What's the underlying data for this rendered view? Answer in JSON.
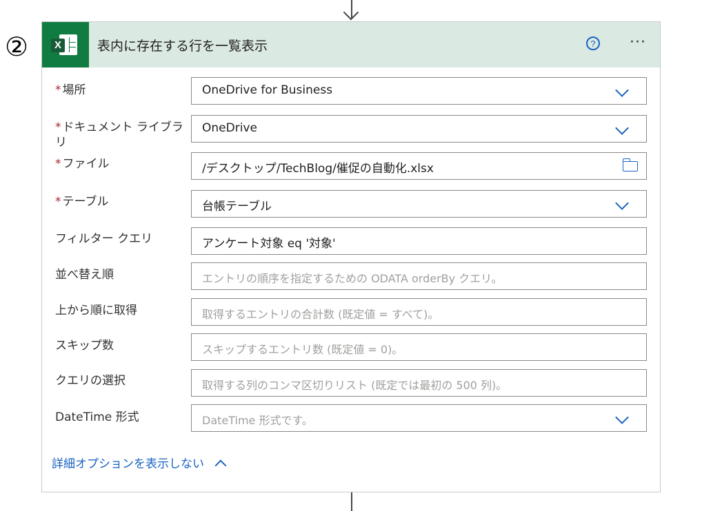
{
  "step_number": "②",
  "card": {
    "title": "表内に存在する行を一覧表示",
    "help_symbol": "?",
    "more_symbol": "···",
    "excel_letter": "X"
  },
  "fields": [
    {
      "label": "場所",
      "required": true,
      "value": "OneDrive for Business",
      "placeholder": "",
      "control": "dropdown"
    },
    {
      "label": "ドキュメント ライブラリ",
      "required": true,
      "value": "OneDrive",
      "placeholder": "",
      "control": "dropdown"
    },
    {
      "label": "ファイル",
      "required": true,
      "value": "/デスクトップ/TechBlog/催促の自動化.xlsx",
      "placeholder": "",
      "control": "file-picker"
    },
    {
      "label": "テーブル",
      "required": true,
      "value": "台帳テーブル",
      "placeholder": "",
      "control": "dropdown"
    },
    {
      "label": "フィルター クエリ",
      "required": false,
      "value": "アンケート対象 eq '対象'",
      "placeholder": "",
      "control": "text"
    },
    {
      "label": "並べ替え順",
      "required": false,
      "value": "",
      "placeholder": "エントリの順序を指定するための ODATA orderBy クエリ。",
      "control": "text"
    },
    {
      "label": "上から順に取得",
      "required": false,
      "value": "",
      "placeholder": "取得するエントリの合計数 (既定値 = すべて)。",
      "control": "text"
    },
    {
      "label": "スキップ数",
      "required": false,
      "value": "",
      "placeholder": "スキップするエントリ数 (既定値 = 0)。",
      "control": "text"
    },
    {
      "label": "クエリの選択",
      "required": false,
      "value": "",
      "placeholder": "取得する列のコンマ区切りリスト (既定では最初の 500 列)。",
      "control": "text"
    },
    {
      "label": "DateTime 形式",
      "required": false,
      "value": "",
      "placeholder": "DateTime 形式です。",
      "control": "dropdown"
    }
  ],
  "required_marker": "*",
  "advanced_link": "詳細オプションを表示しない",
  "colors": {
    "header_bg": "#dbe9e3",
    "excel_green": "#107c41",
    "accent_blue": "#1a62c4",
    "required_red": "#a4262c"
  }
}
